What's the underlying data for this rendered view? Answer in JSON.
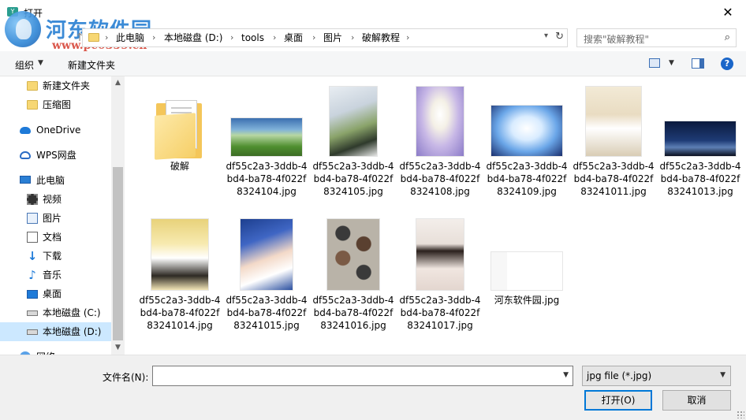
{
  "window": {
    "title": "打开",
    "close_glyph": "✕"
  },
  "watermark": {
    "name": "河东软件园",
    "url": "www.pc0359.cn"
  },
  "address": {
    "segments": [
      "此电脑",
      "本地磁盘 (D:)",
      "tools",
      "桌面",
      "图片",
      "破解教程"
    ]
  },
  "search": {
    "placeholder": "搜索\"破解教程\""
  },
  "toolbar": {
    "organize_label": "组织",
    "new_folder_label": "新建文件夹",
    "help_label": "?"
  },
  "sidebar": {
    "items": [
      {
        "label": "新建文件夹",
        "icon": "folder-icon"
      },
      {
        "label": "压缩图",
        "icon": "folder-icon"
      },
      {
        "label": "OneDrive",
        "icon": "onedrive-icon"
      },
      {
        "label": "WPS网盘",
        "icon": "wps-cloud-icon"
      },
      {
        "label": "此电脑",
        "icon": "this-pc-icon"
      },
      {
        "label": "视频",
        "icon": "video-icon"
      },
      {
        "label": "图片",
        "icon": "pictures-icon"
      },
      {
        "label": "文档",
        "icon": "documents-icon"
      },
      {
        "label": "下载",
        "icon": "download-icon"
      },
      {
        "label": "音乐",
        "icon": "music-icon"
      },
      {
        "label": "桌面",
        "icon": "desktop-icon"
      },
      {
        "label": "本地磁盘 (C:)",
        "icon": "drive-icon"
      },
      {
        "label": "本地磁盘 (D:)",
        "icon": "drive-icon",
        "selected": true
      },
      {
        "label": "网络",
        "icon": "network-icon"
      }
    ]
  },
  "files": [
    {
      "name": "破解",
      "type": "folder"
    },
    {
      "name": "df55c2a3-3ddb-4bd4-ba78-4f022f8324104.jpg",
      "type": "image"
    },
    {
      "name": "df55c2a3-3ddb-4bd4-ba78-4f022f8324105.jpg",
      "type": "image"
    },
    {
      "name": "df55c2a3-3ddb-4bd4-ba78-4f022f8324108.jpg",
      "type": "image"
    },
    {
      "name": "df55c2a3-3ddb-4bd4-ba78-4f022f8324109.jpg",
      "type": "image"
    },
    {
      "name": "df55c2a3-3ddb-4bd4-ba78-4f022f83241011.jpg",
      "type": "image"
    },
    {
      "name": "df55c2a3-3ddb-4bd4-ba78-4f022f83241013.jpg",
      "type": "image"
    },
    {
      "name": "df55c2a3-3ddb-4bd4-ba78-4f022f83241014.jpg",
      "type": "image"
    },
    {
      "name": "df55c2a3-3ddb-4bd4-ba78-4f022f83241015.jpg",
      "type": "image"
    },
    {
      "name": "df55c2a3-3ddb-4bd4-ba78-4f022f83241016.jpg",
      "type": "image"
    },
    {
      "name": "df55c2a3-3ddb-4bd4-ba78-4f022f83241017.jpg",
      "type": "image"
    },
    {
      "name": "河东软件园.jpg",
      "type": "image"
    }
  ],
  "bottom": {
    "filename_label": "文件名(N):",
    "filename_value": "",
    "filetype_value": "jpg file (*.jpg)",
    "open_label": "打开(O)",
    "cancel_label": "取消"
  },
  "colors": {
    "accent": "#0078d7",
    "selection": "#cce8ff"
  }
}
